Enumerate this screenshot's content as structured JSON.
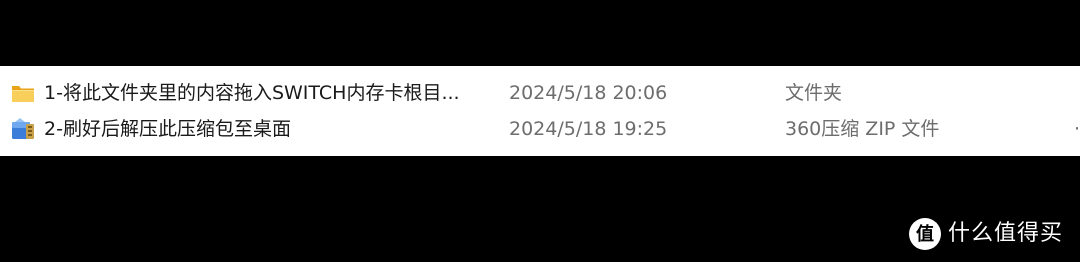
{
  "files": [
    {
      "icon": "folder-icon",
      "name": "1-将此文件夹里的内容拖入SWITCH内存卡根目...",
      "modified": "2024/5/18 20:06",
      "type": "文件夹"
    },
    {
      "icon": "zip-archive-icon",
      "name": "2-刷好后解压此压缩包至桌面",
      "modified": "2024/5/18 19:25",
      "type": "360压缩 ZIP 文件",
      "size_truncated": "·"
    }
  ],
  "watermark": {
    "text": "什么值得买",
    "logo": "smzdm-logo"
  },
  "colors": {
    "background": "#000000",
    "panel": "#ffffff",
    "folder": "#f5c242",
    "secondary_text": "#6d6d6d"
  }
}
